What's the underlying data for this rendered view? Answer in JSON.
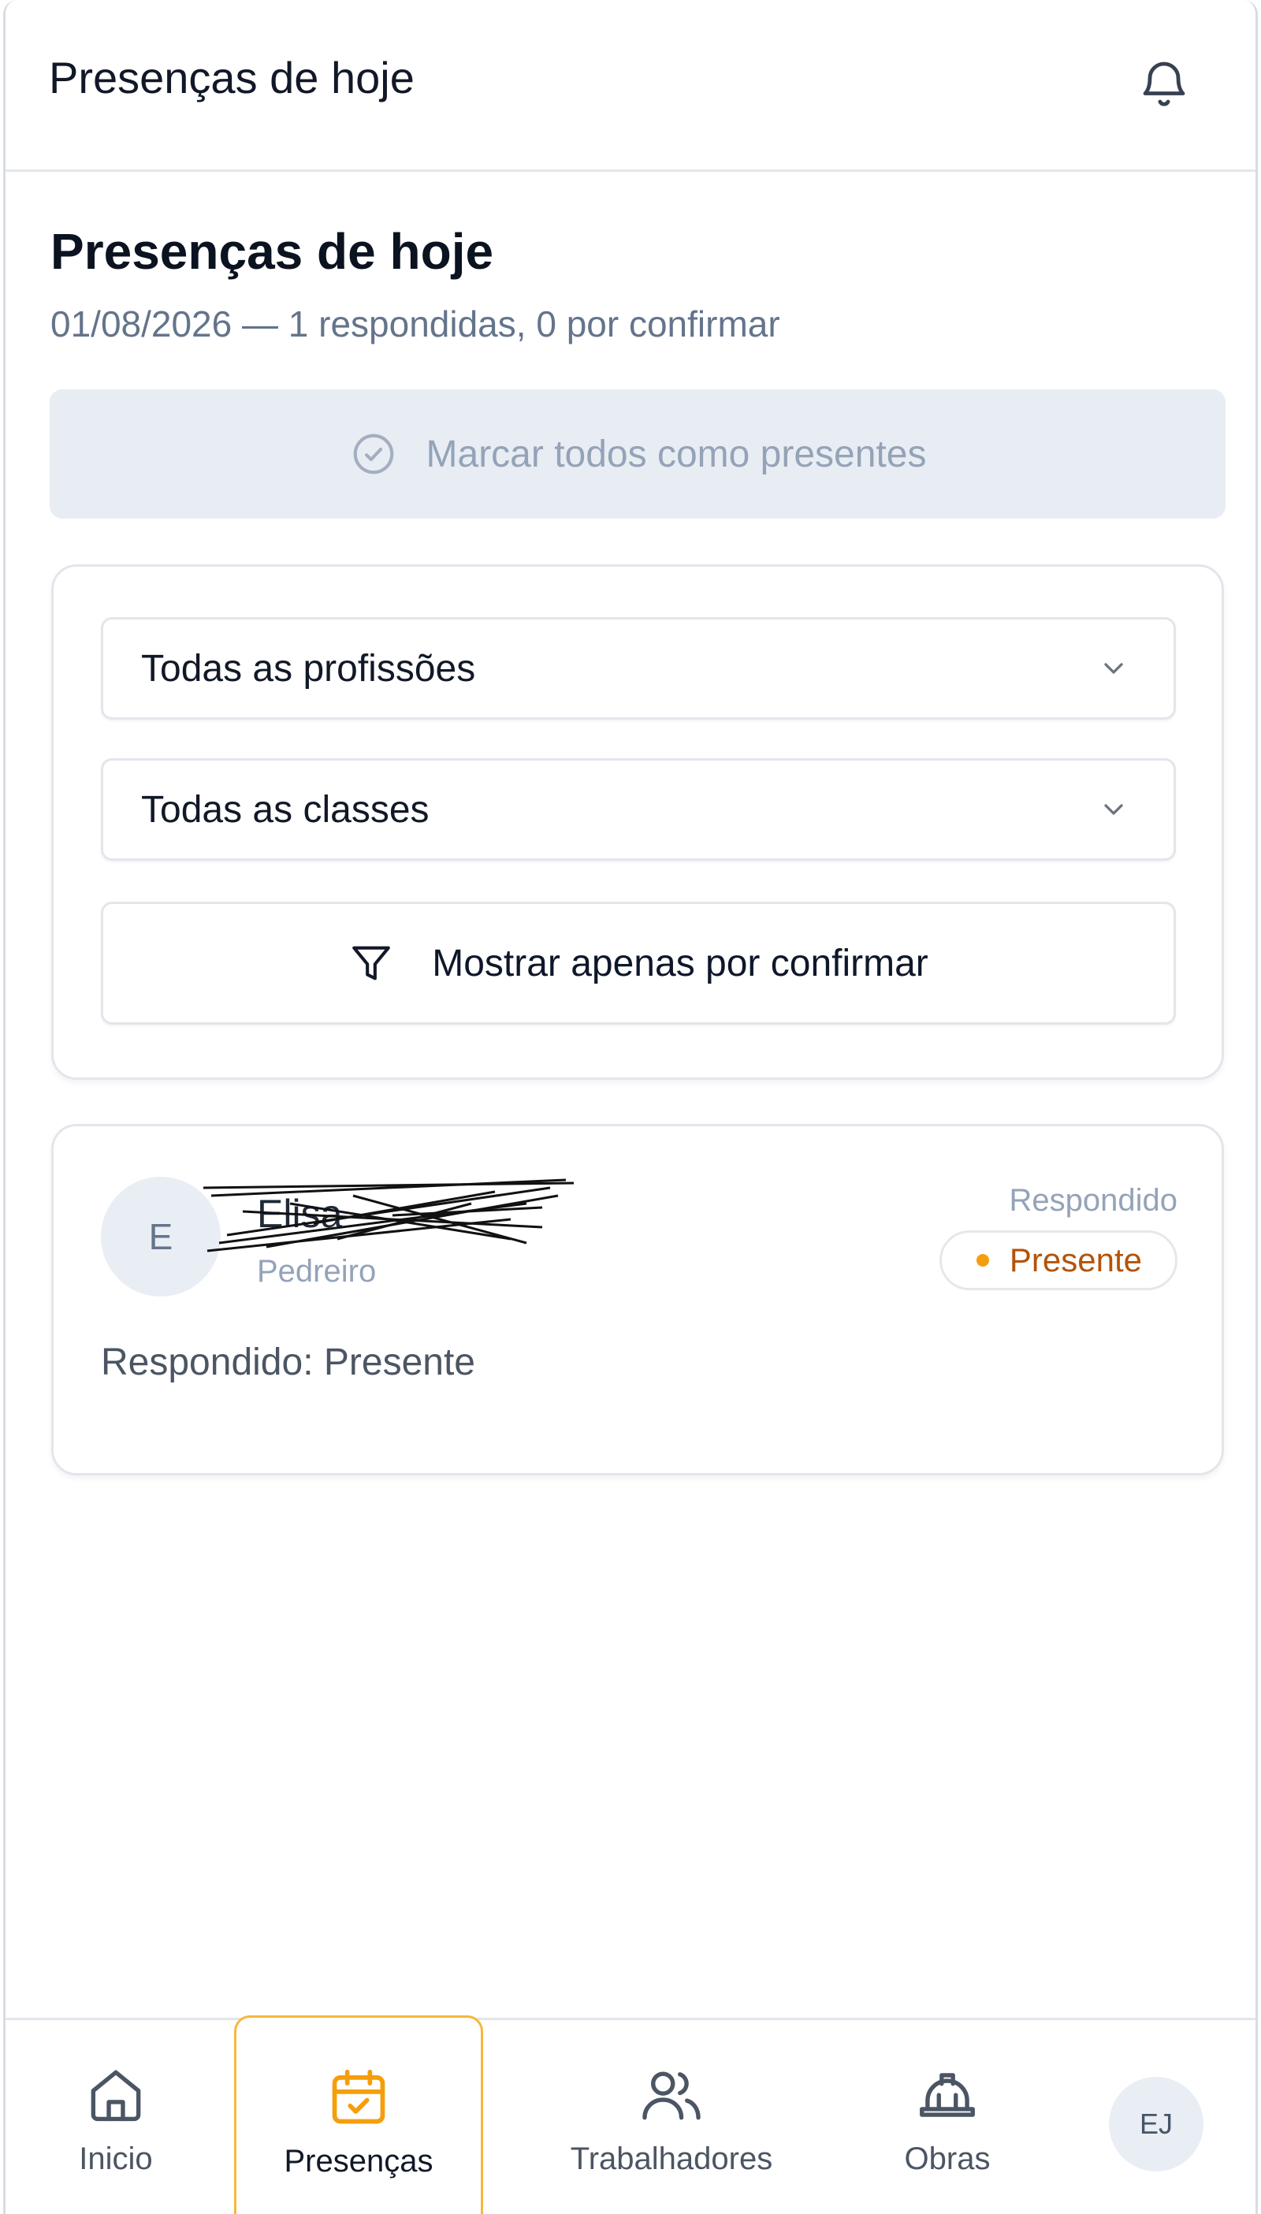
{
  "header": {
    "title": "Presenças de hoje",
    "notification_icon": "bell-icon"
  },
  "page": {
    "title": "Presenças de hoje",
    "subtitle": "01/08/2026 — 1 respondidas, 0 por confirmar"
  },
  "mark_all": {
    "label": "Marcar todos como presentes",
    "icon": "check-circle-icon",
    "disabled": true
  },
  "filters": {
    "profession": {
      "value": "Todas as profissões"
    },
    "class": {
      "value": "Todas as classes"
    },
    "only_pending": {
      "label": "Mostrar apenas por confirmar",
      "icon": "filter-icon"
    }
  },
  "workers": [
    {
      "initial": "E",
      "name": "Elisa",
      "role": "Pedreiro",
      "answer_label": "Respondido",
      "status": "Presente",
      "answer_text": "Respondido: Presente"
    }
  ],
  "bottom_nav": {
    "items": [
      {
        "label": "Inicio",
        "icon": "home-icon"
      },
      {
        "label": "Presenças",
        "icon": "calendar-check-icon",
        "active": true
      },
      {
        "label": "Trabalhadores",
        "icon": "users-icon"
      },
      {
        "label": "Obras",
        "icon": "hard-hat-icon"
      }
    ],
    "user_initials": "EJ"
  },
  "colors": {
    "accent": "#f59e0b",
    "status_text": "#b45309",
    "muted": "#94a3b8",
    "border": "#e2e6ec"
  }
}
